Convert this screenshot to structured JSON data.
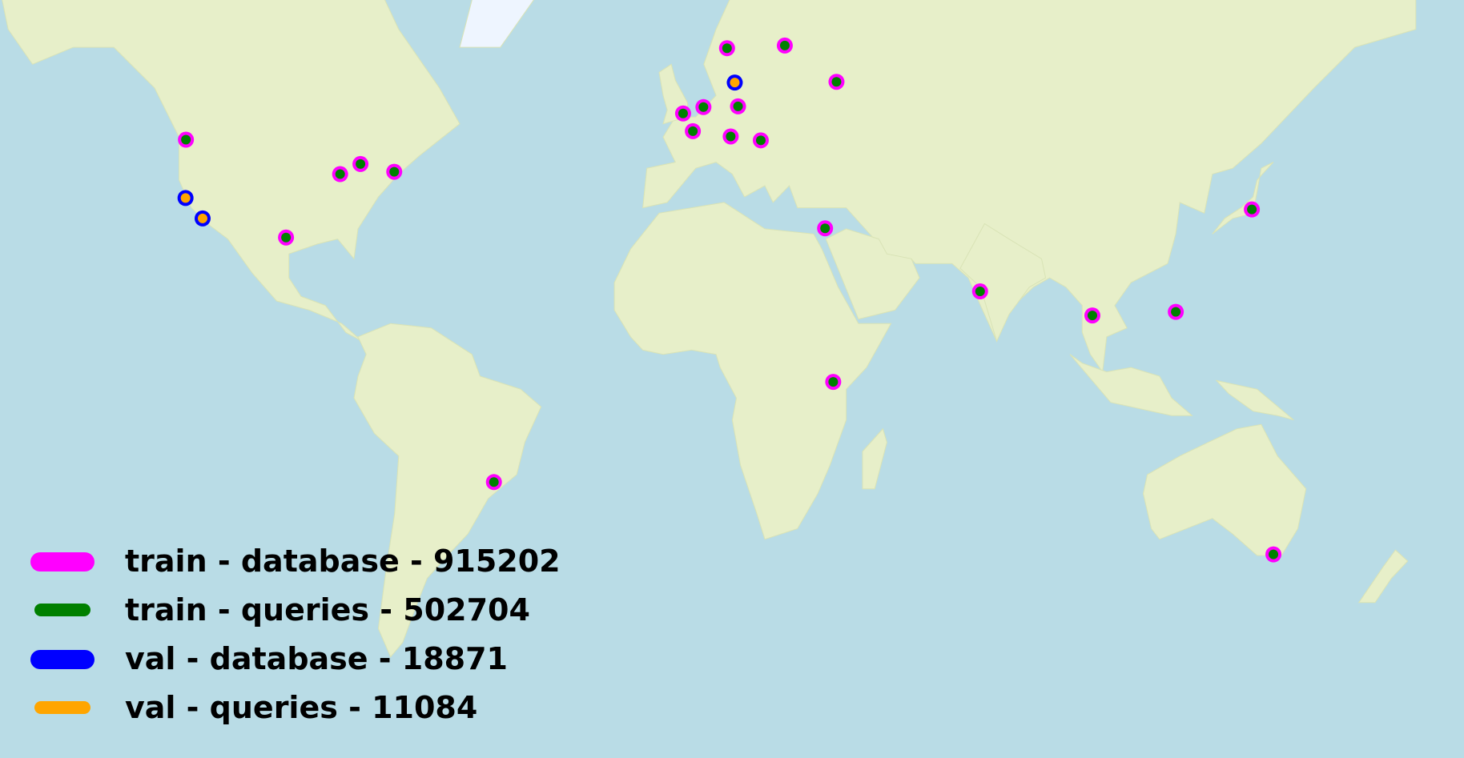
{
  "map": {
    "ocean_color": "#b9dce6",
    "land_color": "#e7efc9",
    "ice_color": "#eef5ff",
    "markers": [
      {
        "label": "train",
        "lon": -122.3,
        "lat": 47.6
      },
      {
        "label": "train",
        "lon": -97.7,
        "lat": 30.3
      },
      {
        "label": "train",
        "lon": -84.4,
        "lat": 42.0
      },
      {
        "label": "train",
        "lon": -79.4,
        "lat": 43.7
      },
      {
        "label": "train",
        "lon": -71.1,
        "lat": 42.4
      },
      {
        "label": "val",
        "lon": -122.4,
        "lat": 37.8
      },
      {
        "label": "val",
        "lon": -118.2,
        "lat": 34.0
      },
      {
        "label": "train",
        "lon": -46.6,
        "lat": -23.6
      },
      {
        "label": "train",
        "lon": 10.7,
        "lat": 59.9
      },
      {
        "label": "train",
        "lon": 24.9,
        "lat": 60.2
      },
      {
        "label": "val",
        "lon": 12.6,
        "lat": 55.7
      },
      {
        "label": "train",
        "lon": 37.6,
        "lat": 55.8
      },
      {
        "label": "train",
        "lon": -0.1,
        "lat": 51.5
      },
      {
        "label": "train",
        "lon": 4.9,
        "lat": 52.4
      },
      {
        "label": "train",
        "lon": 13.4,
        "lat": 52.5
      },
      {
        "label": "train",
        "lon": 2.3,
        "lat": 48.9
      },
      {
        "label": "train",
        "lon": 11.6,
        "lat": 48.1
      },
      {
        "label": "train",
        "lon": 19.0,
        "lat": 47.5
      },
      {
        "label": "train",
        "lon": 34.8,
        "lat": 32.1
      },
      {
        "label": "train",
        "lon": 72.9,
        "lat": 19.1
      },
      {
        "label": "train",
        "lon": 100.5,
        "lat": 13.8
      },
      {
        "label": "train",
        "lon": 121.0,
        "lat": 14.6
      },
      {
        "label": "train",
        "lon": 139.7,
        "lat": 35.7
      },
      {
        "label": "train",
        "lon": 36.8,
        "lat": -1.3
      },
      {
        "label": "train",
        "lon": 145.0,
        "lat": -37.8
      }
    ]
  },
  "legend": {
    "items": [
      {
        "label": "train - database - 915202",
        "color": "#ff00ff"
      },
      {
        "label": "train - queries - 502704",
        "color": "#008000"
      },
      {
        "label": "val - database - 18871",
        "color": "#0000ff"
      },
      {
        "label": "val - queries - 11084",
        "color": "#ffa500"
      }
    ]
  }
}
